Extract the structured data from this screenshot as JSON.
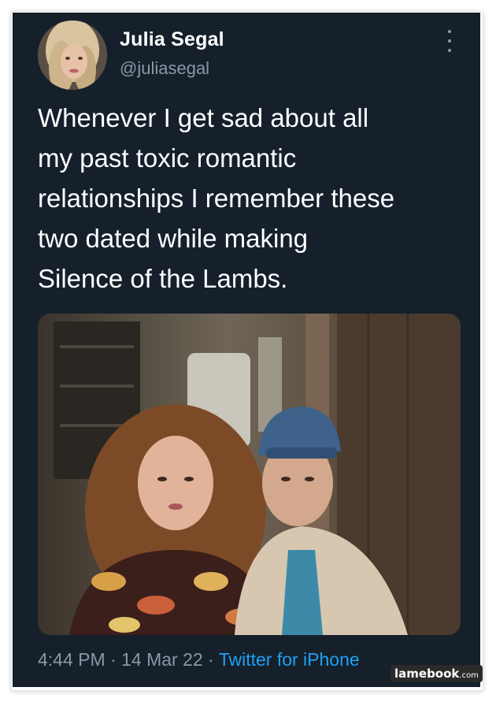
{
  "author": {
    "name": "Julia Segal",
    "handle": "@juliasegal"
  },
  "tweet": {
    "text_lines": [
      "Whenever I get sad about all",
      "my past toxic romantic",
      "relationships I remember these",
      "two dated while making",
      "Silence of the Lambs."
    ]
  },
  "meta": {
    "time": "4:44 PM",
    "separator": " · ",
    "date": "14 Mar 22",
    "source": "Twitter for iPhone"
  },
  "watermark": {
    "brand": "lamebook",
    "tld": ".com"
  },
  "icons": {
    "more": "more-vertical-icon"
  },
  "colors": {
    "background": "#15202b",
    "name": "#ffffff",
    "secondary": "#8899a6",
    "link": "#1da1f2"
  }
}
